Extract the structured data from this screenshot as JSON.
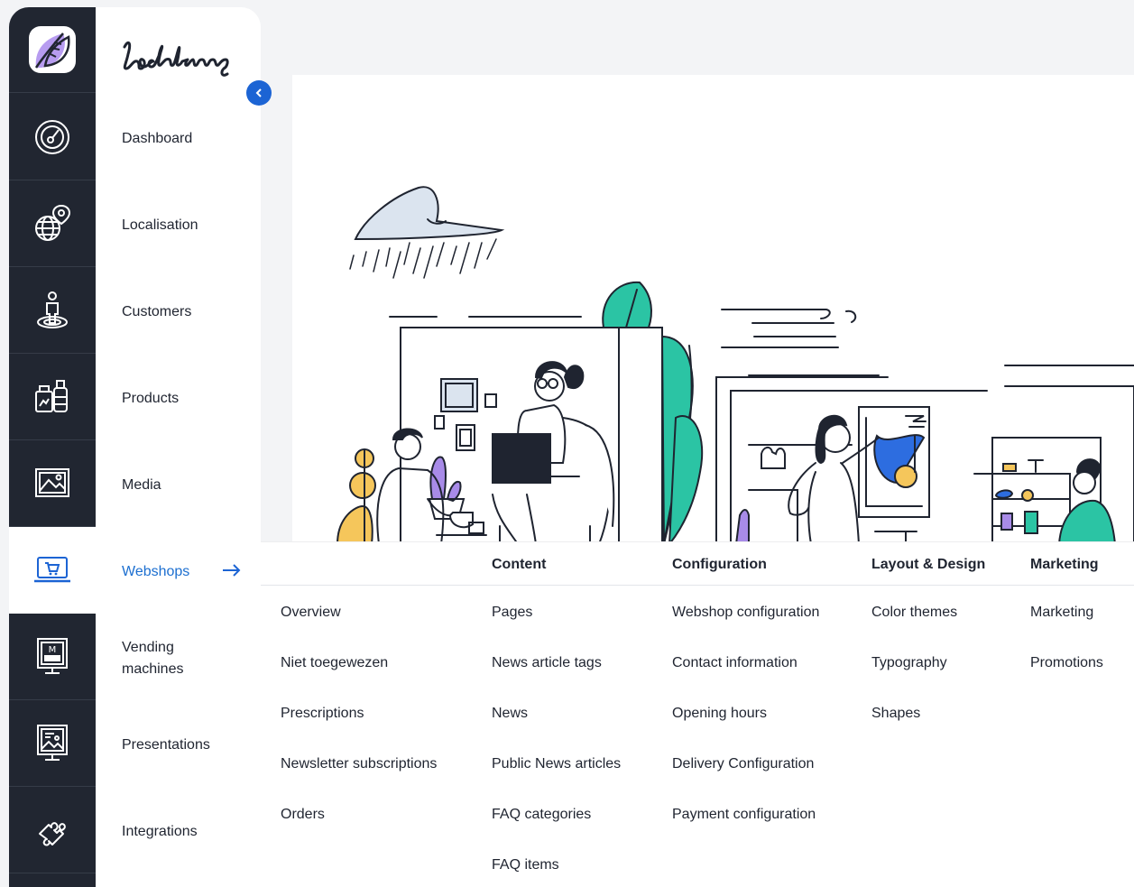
{
  "brand": {
    "name": "lochting"
  },
  "nav": {
    "items": [
      {
        "label": "Dashboard",
        "icon": "dashboard-gauge-icon"
      },
      {
        "label": "Localisation",
        "icon": "globe-pin-icon"
      },
      {
        "label": "Customers",
        "icon": "person-pin-icon"
      },
      {
        "label": "Products",
        "icon": "products-jars-icon"
      },
      {
        "label": "Media",
        "icon": "media-image-icon"
      },
      {
        "label": "Webshops",
        "icon": "webshop-laptop-cart-icon",
        "active": true
      },
      {
        "label": "Vending machines",
        "icon": "vending-machine-icon"
      },
      {
        "label": "Presentations",
        "icon": "presentation-screen-icon"
      },
      {
        "label": "Integrations",
        "icon": "puzzle-icon"
      }
    ]
  },
  "colors": {
    "rail_bg": "#212631",
    "accent": "#1c6fd0",
    "teal": "#2bc4a4",
    "purple": "#a88be8",
    "yellow": "#f5c65b"
  },
  "mega_menu": {
    "general": [
      "Overview",
      "Niet toegewezen",
      "Prescriptions",
      "Newsletter subscriptions",
      "Orders"
    ],
    "content": {
      "title": "Content",
      "items": [
        "Pages",
        "News article tags",
        "News",
        "Public News articles",
        "FAQ categories",
        "FAQ items"
      ]
    },
    "configuration": {
      "title": "Configuration",
      "items": [
        "Webshop configuration",
        "Contact information",
        "Opening hours",
        "Delivery Configuration",
        "Payment configuration"
      ]
    },
    "layout_design": {
      "title": "Layout & Design",
      "items": [
        "Color themes",
        "Typography",
        "Shapes"
      ]
    },
    "marketing": {
      "title": "Marketing",
      "items": [
        "Marketing",
        "Promotions"
      ]
    }
  }
}
